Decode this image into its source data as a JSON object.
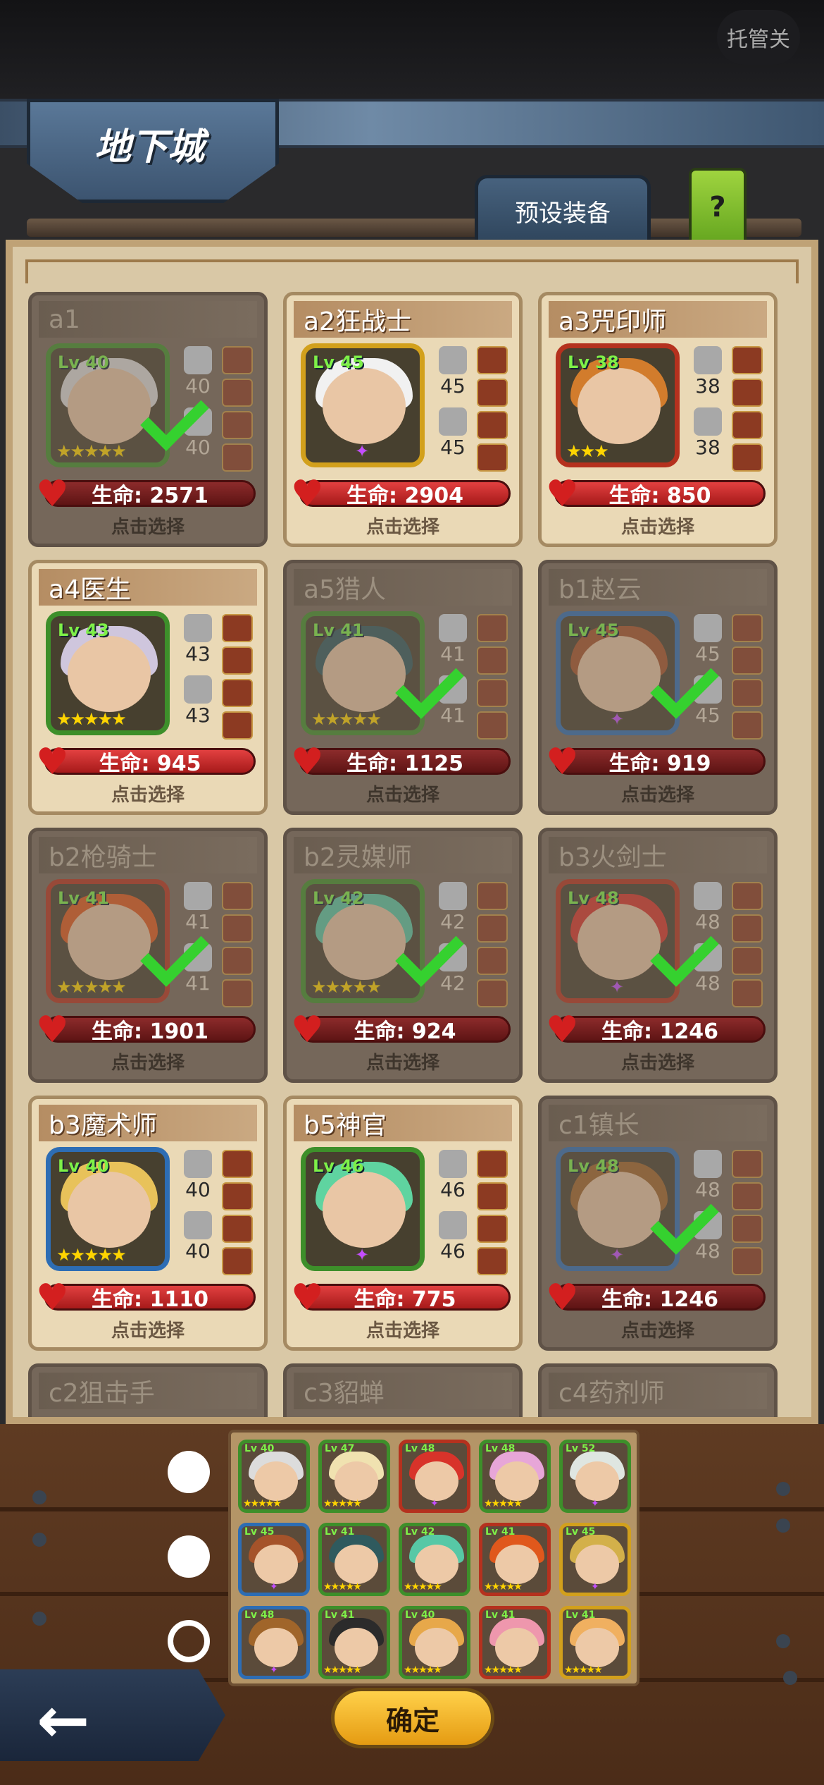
{
  "header": {
    "auto_button": "托管关",
    "title": "地下城",
    "preset_tab": "预设装备",
    "help_tab": "?"
  },
  "select_label": "点击选择",
  "heroes": [
    {
      "name": "a1",
      "level": "Lv 40",
      "atk": "40",
      "def": "40",
      "hp": "生命: 2571",
      "stars": 5,
      "dim": true,
      "checked": true,
      "frame": "green",
      "hair": "#dcdcdc"
    },
    {
      "name": "a2狂战士",
      "level": "Lv 45",
      "atk": "45",
      "def": "45",
      "hp": "生命: 2904",
      "stars": 0,
      "dim": false,
      "checked": false,
      "frame": "gold",
      "hair": "#f1f1f1"
    },
    {
      "name": "a3咒印师",
      "level": "Lv 38",
      "atk": "38",
      "def": "38",
      "hp": "生命: 850",
      "stars": 3,
      "dim": false,
      "checked": false,
      "frame": "red",
      "hair": "#d27c2c"
    },
    {
      "name": "a4医生",
      "level": "Lv 43",
      "atk": "43",
      "def": "43",
      "hp": "生命: 945",
      "stars": 5,
      "dim": false,
      "checked": false,
      "frame": "green",
      "hair": "#cfc6dd"
    },
    {
      "name": "a5猎人",
      "level": "Lv 41",
      "atk": "41",
      "def": "41",
      "hp": "生命: 1125",
      "stars": 5,
      "dim": true,
      "checked": true,
      "frame": "green",
      "hair": "#2f5a5e"
    },
    {
      "name": "b1赵云",
      "level": "Lv 45",
      "atk": "45",
      "def": "45",
      "hp": "生命: 919",
      "stars": 0,
      "dim": true,
      "checked": true,
      "frame": "blue",
      "hair": "#a5532a"
    },
    {
      "name": "b2枪骑士",
      "level": "Lv 41",
      "atk": "41",
      "def": "41",
      "hp": "生命: 1901",
      "stars": 5,
      "dim": true,
      "checked": true,
      "frame": "red",
      "hair": "#e0581c"
    },
    {
      "name": "b2灵媒师",
      "level": "Lv 42",
      "atk": "42",
      "def": "42",
      "hp": "生命: 924",
      "stars": 5,
      "dim": true,
      "checked": true,
      "frame": "green",
      "hair": "#57c8a6"
    },
    {
      "name": "b3火剑士",
      "level": "Lv 48",
      "atk": "48",
      "def": "48",
      "hp": "生命: 1246",
      "stars": 0,
      "dim": true,
      "checked": true,
      "frame": "red",
      "hair": "#d8332a"
    },
    {
      "name": "b3魔术师",
      "level": "Lv 40",
      "atk": "40",
      "def": "40",
      "hp": "生命: 1110",
      "stars": 5,
      "dim": false,
      "checked": false,
      "frame": "blue",
      "hair": "#e8c25a"
    },
    {
      "name": "b5神官",
      "level": "Lv 46",
      "atk": "46",
      "def": "46",
      "hp": "生命: 775",
      "stars": 0,
      "dim": false,
      "checked": false,
      "frame": "green",
      "hair": "#5fd4a0"
    },
    {
      "name": "c1镇长",
      "level": "Lv 48",
      "atk": "48",
      "def": "48",
      "hp": "生命: 1246",
      "stars": 0,
      "dim": true,
      "checked": true,
      "frame": "blue",
      "hair": "#a0652a"
    },
    {
      "name": "c2狙击手",
      "dim": true,
      "partial": true
    },
    {
      "name": "c3貂蝉",
      "dim": true,
      "partial": true
    },
    {
      "name": "c4药剂师",
      "dim": true,
      "partial": true
    }
  ],
  "teams": [
    {
      "selected": false,
      "members": [
        {
          "level": "Lv 40",
          "frame": "green",
          "hair": "#dcdcdc",
          "stars": 5
        },
        {
          "level": "Lv 47",
          "frame": "green",
          "hair": "#f0e2b0",
          "stars": 5
        },
        {
          "level": "Lv 48",
          "frame": "red",
          "hair": "#d8332a",
          "stars": 1
        },
        {
          "level": "Lv 48",
          "frame": "green",
          "hair": "#e7a6d8",
          "stars": 5
        },
        {
          "level": "Lv 52",
          "frame": "green",
          "hair": "#dfe6e1",
          "stars": 1
        }
      ]
    },
    {
      "selected": false,
      "members": [
        {
          "level": "Lv 45",
          "frame": "blue",
          "hair": "#a5532a",
          "stars": 1
        },
        {
          "level": "Lv 41",
          "frame": "green",
          "hair": "#2f5a5e",
          "stars": 5
        },
        {
          "level": "Lv 42",
          "frame": "green",
          "hair": "#57c8a6",
          "stars": 5
        },
        {
          "level": "Lv 41",
          "frame": "red",
          "hair": "#e0581c",
          "stars": 5
        },
        {
          "level": "Lv 45",
          "frame": "gold",
          "hair": "#d3b04a",
          "stars": 1
        }
      ]
    },
    {
      "selected": true,
      "members": [
        {
          "level": "Lv 48",
          "frame": "blue",
          "hair": "#a0652a",
          "stars": 1
        },
        {
          "level": "Lv 41",
          "frame": "green",
          "hair": "#2b2b2b",
          "stars": 5
        },
        {
          "level": "Lv 40",
          "frame": "green",
          "hair": "#e7a84a",
          "stars": 5
        },
        {
          "level": "Lv 41",
          "frame": "red",
          "hair": "#ee97ad",
          "stars": 5
        },
        {
          "level": "Lv 41",
          "frame": "gold",
          "hair": "#f0b060",
          "stars": 5
        }
      ]
    }
  ],
  "footer": {
    "back": "←",
    "confirm": "确定"
  }
}
